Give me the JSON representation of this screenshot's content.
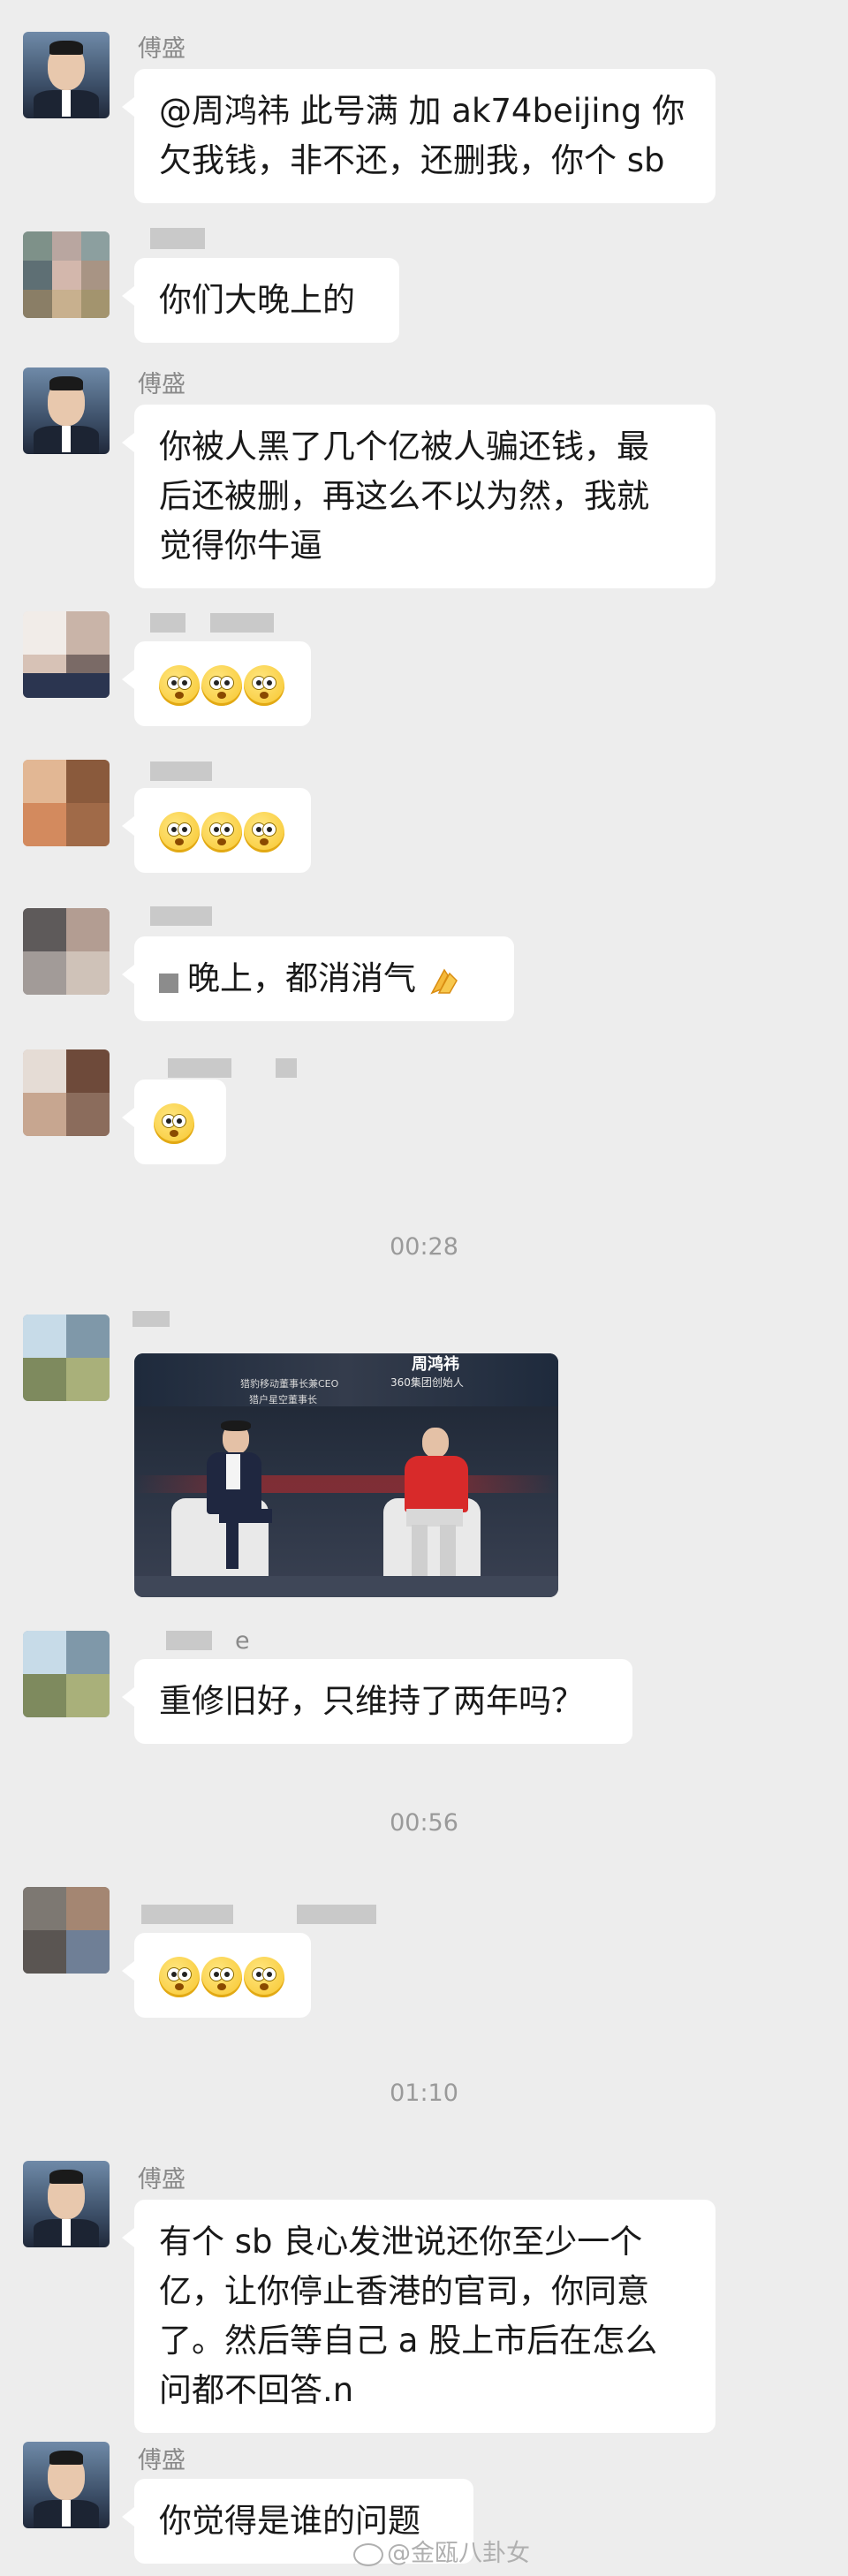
{
  "messages": [
    {
      "sender": "傅盛",
      "text": "@周鸿祎 此号满 加 ak74beijing 你欠我钱，非不还，还删我，你个sb"
    },
    {
      "sender": "",
      "text": "你们大晚上的"
    },
    {
      "sender": "傅盛",
      "text": "你被人黑了几个亿被人骗还钱，最后还被删，再这么不以为然，我就觉得你牛逼"
    },
    {
      "sender": "",
      "text": ""
    },
    {
      "sender": "",
      "text": ""
    },
    {
      "sender": "",
      "text": "晚上，都消消气"
    },
    {
      "sender": "",
      "text": ""
    },
    {
      "sender": "",
      "text": "重修旧好，只维持了两年吗？"
    },
    {
      "sender": "",
      "text": ""
    },
    {
      "sender": "傅盛",
      "text": "有个sb良心发泄说还你至少一个亿，让你停止香港的官司，你同意了。然后等自己a股上市后在怎么问都不回答.n"
    },
    {
      "sender": "傅盛",
      "text": "你觉得是谁的问题"
    }
  ],
  "message_lines": {
    "m1": [
      "@周鸿祎 此号满 加 ak74beijing 你",
      "欠我钱，非不还，还删我，你个 sb"
    ],
    "m3": [
      "你被人黑了几个亿被人骗还钱，最",
      "后还被删，再这么不以为然，我就",
      "觉得你牛逼"
    ],
    "m10": [
      "有个 sb 良心发泄说还你至少一个",
      "亿，让你停止香港的官司，你同意",
      "了。然后等自己 a 股上市后在怎么",
      "问都不回答.n"
    ]
  },
  "timestamps": [
    "00:28",
    "00:56",
    "01:10"
  ],
  "image_message": {
    "title": "周鸿祎",
    "subtitle_right": "360集团创始人",
    "subtitle_left_1": "猎豹移动董事长兼CEO",
    "subtitle_left_2": "猎户星空董事长"
  },
  "partial_name_suffix": "e",
  "watermark": "@金瓯八卦女",
  "colors": {
    "background": "#ededed",
    "bubble": "#ffffff",
    "meta_text": "#9a9a9a"
  }
}
